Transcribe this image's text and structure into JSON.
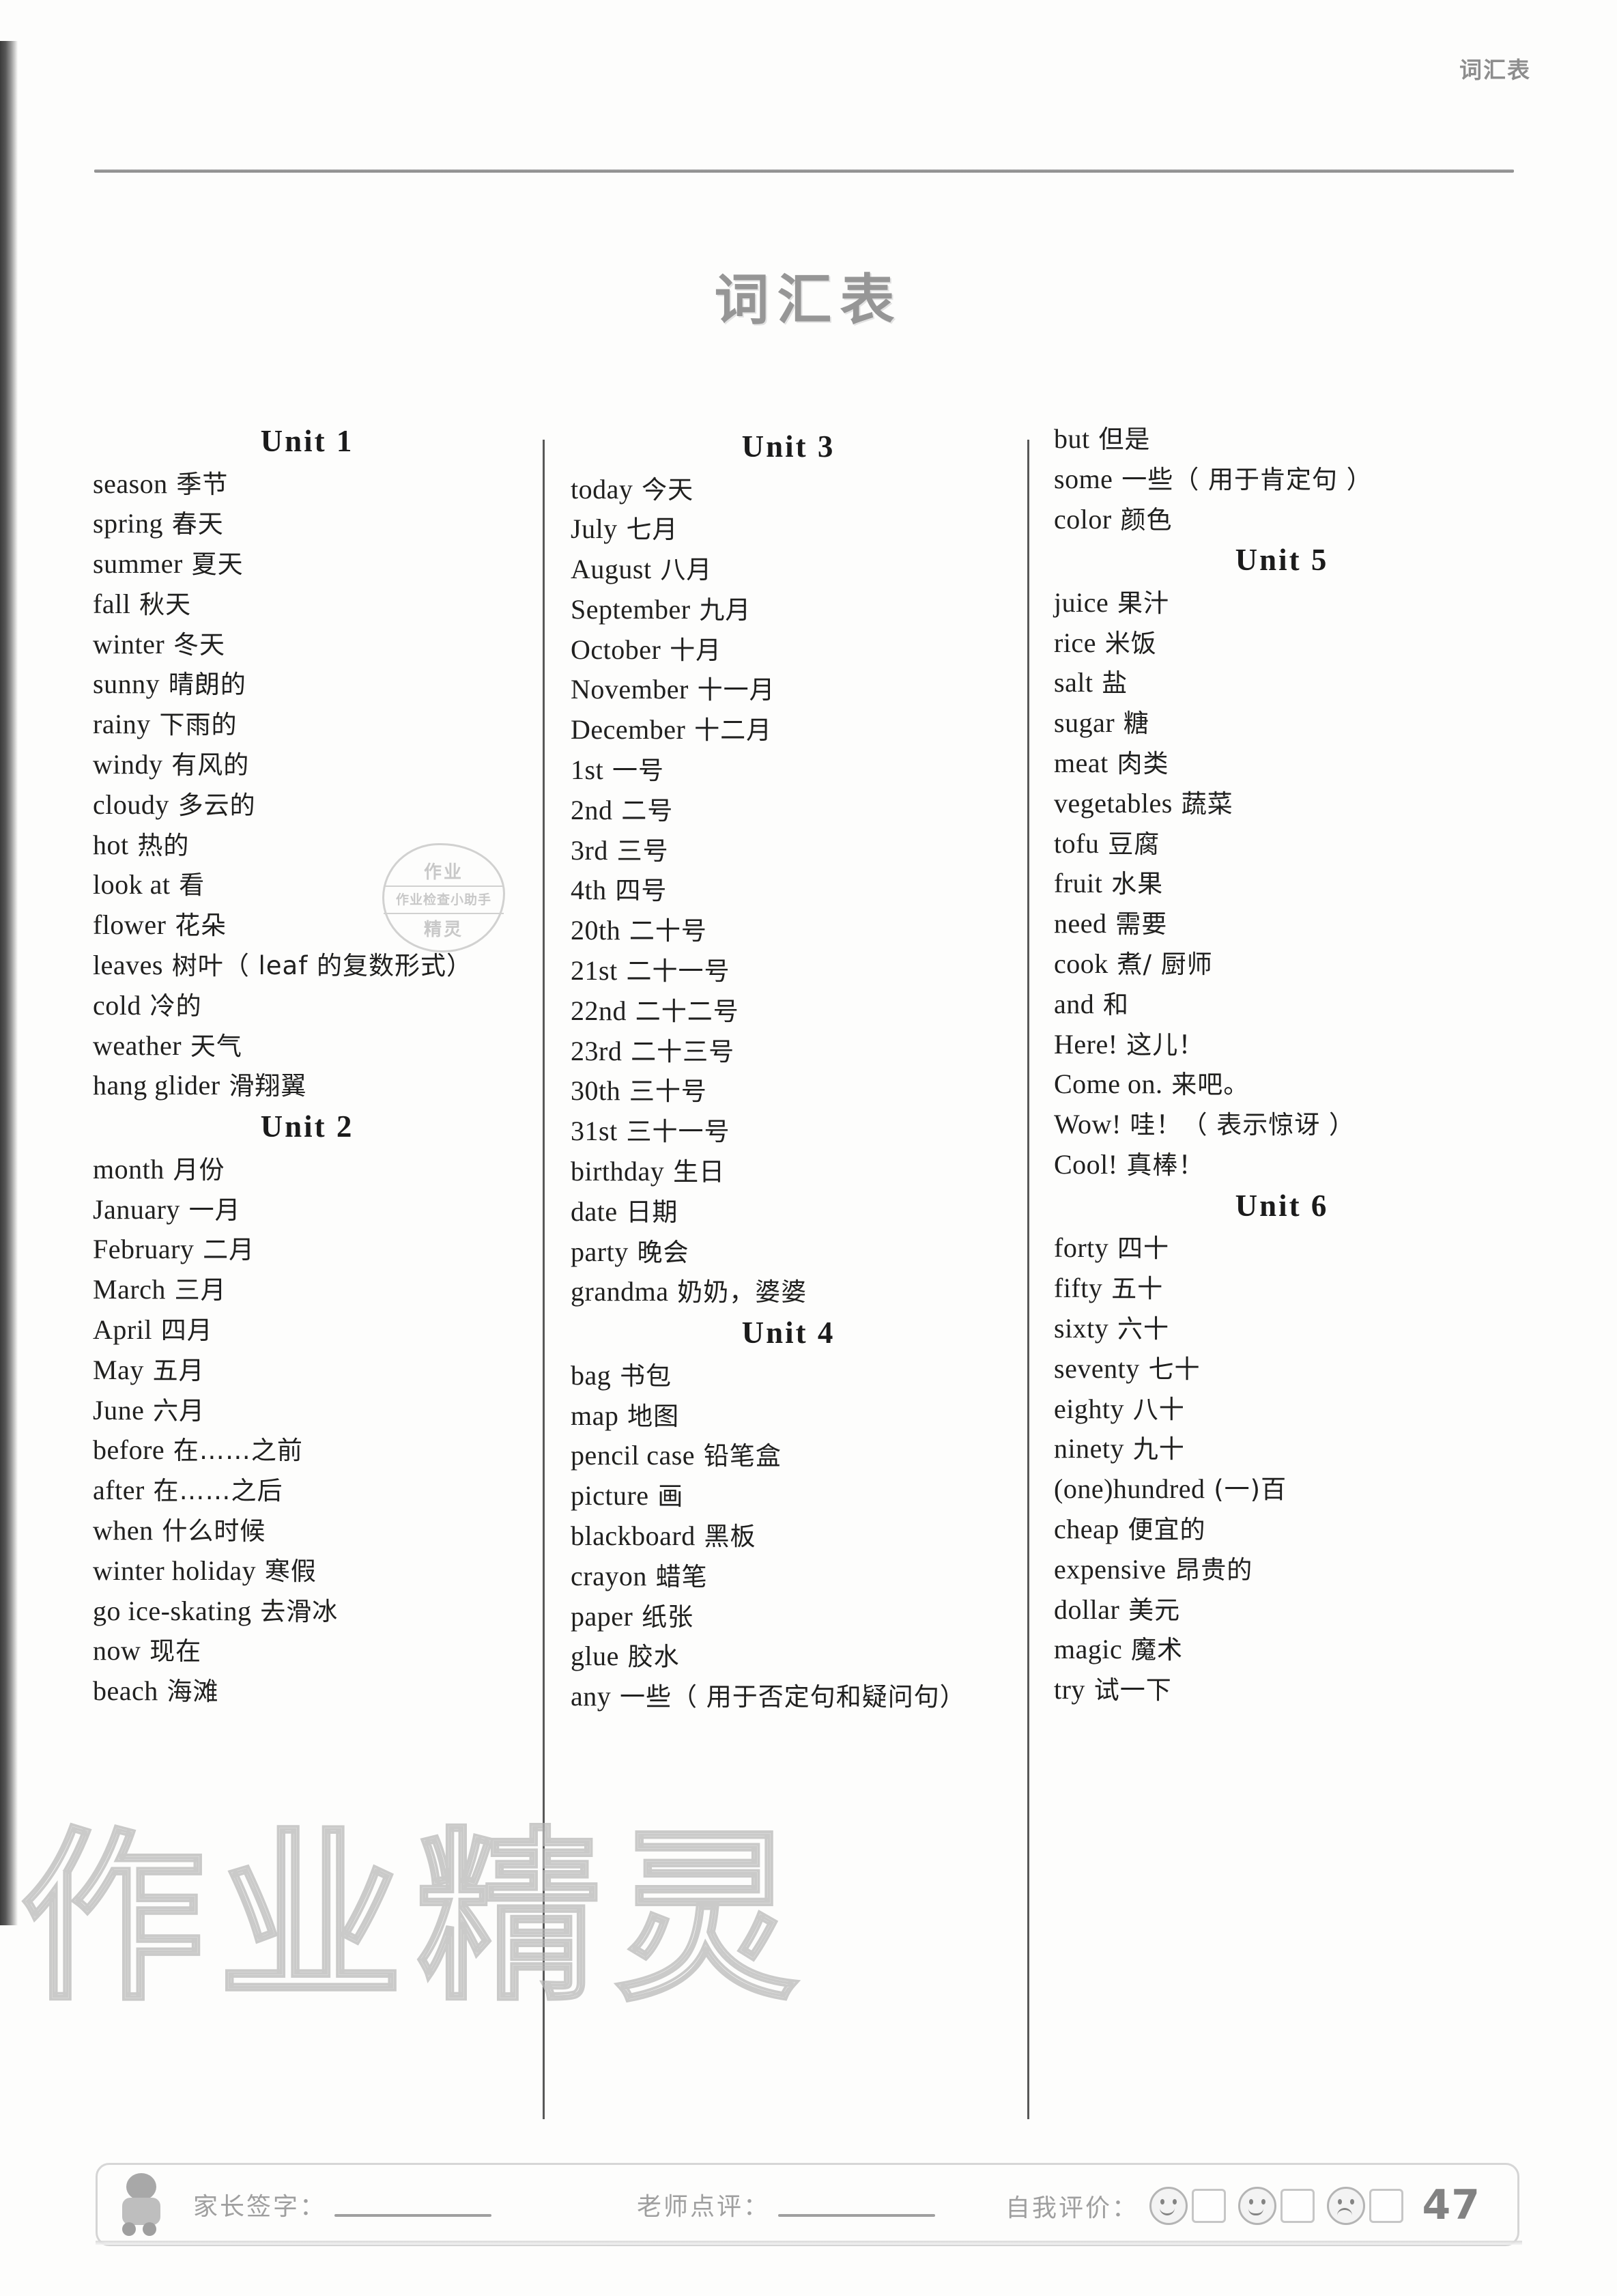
{
  "running_head": "词汇表",
  "page_title": "词汇表",
  "watermark": "作业精灵",
  "stamp": {
    "line1": "作业",
    "line2": "作业检查小助手",
    "line3": "精灵"
  },
  "columns": [
    {
      "id": "column-1",
      "blocks": [
        {
          "unit": "Unit 1",
          "entries": [
            {
              "en": "season",
              "cn": "季节"
            },
            {
              "en": "spring",
              "cn": "春天"
            },
            {
              "en": "summer",
              "cn": "夏天"
            },
            {
              "en": "fall",
              "cn": "秋天"
            },
            {
              "en": "winter",
              "cn": "冬天"
            },
            {
              "en": "sunny",
              "cn": "晴朗的"
            },
            {
              "en": "rainy",
              "cn": "下雨的"
            },
            {
              "en": "windy",
              "cn": "有风的"
            },
            {
              "en": "cloudy",
              "cn": "多云的"
            },
            {
              "en": "hot",
              "cn": "热的"
            },
            {
              "en": "look at",
              "cn": "看"
            },
            {
              "en": "flower",
              "cn": "花朵"
            },
            {
              "en": "leaves",
              "cn": "树叶（ leaf 的复数形式）"
            },
            {
              "en": "cold",
              "cn": "冷的"
            },
            {
              "en": "weather",
              "cn": "天气"
            },
            {
              "en": "hang glider",
              "cn": "滑翔翼"
            }
          ]
        },
        {
          "unit": "Unit 2",
          "entries": [
            {
              "en": "month",
              "cn": "月份"
            },
            {
              "en": "January",
              "cn": "一月"
            },
            {
              "en": "February",
              "cn": "二月"
            },
            {
              "en": "March",
              "cn": "三月"
            },
            {
              "en": "April",
              "cn": "四月"
            },
            {
              "en": "May",
              "cn": "五月"
            },
            {
              "en": "June",
              "cn": "六月"
            },
            {
              "en": "before",
              "cn": "在……之前"
            },
            {
              "en": "after",
              "cn": "在……之后"
            },
            {
              "en": "when",
              "cn": "什么时候"
            },
            {
              "en": "winter holiday",
              "cn": "寒假"
            },
            {
              "en": "go ice-skating",
              "cn": "去滑冰"
            },
            {
              "en": "now",
              "cn": "现在"
            },
            {
              "en": "beach",
              "cn": "海滩"
            }
          ]
        }
      ]
    },
    {
      "id": "column-2",
      "blocks": [
        {
          "unit": "Unit 3",
          "entries": [
            {
              "en": "today",
              "cn": "今天"
            },
            {
              "en": "July",
              "cn": "七月"
            },
            {
              "en": "August",
              "cn": "八月"
            },
            {
              "en": "September",
              "cn": "九月"
            },
            {
              "en": "October",
              "cn": "十月"
            },
            {
              "en": "November",
              "cn": "十一月"
            },
            {
              "en": "December",
              "cn": "十二月"
            },
            {
              "en": "1st",
              "cn": "一号"
            },
            {
              "en": "2nd",
              "cn": "二号"
            },
            {
              "en": "3rd",
              "cn": "三号"
            },
            {
              "en": "4th",
              "cn": "四号"
            },
            {
              "en": "20th",
              "cn": "二十号"
            },
            {
              "en": "21st",
              "cn": "二十一号"
            },
            {
              "en": "22nd",
              "cn": "二十二号"
            },
            {
              "en": "23rd",
              "cn": "二十三号"
            },
            {
              "en": "30th",
              "cn": "三十号"
            },
            {
              "en": "31st",
              "cn": "三十一号"
            },
            {
              "en": "birthday",
              "cn": "生日"
            },
            {
              "en": "date",
              "cn": "日期"
            },
            {
              "en": "party",
              "cn": "晚会"
            },
            {
              "en": "grandma",
              "cn": "奶奶，婆婆"
            }
          ]
        },
        {
          "unit": "Unit 4",
          "entries": [
            {
              "en": "bag",
              "cn": "书包"
            },
            {
              "en": "map",
              "cn": "地图"
            },
            {
              "en": "pencil case",
              "cn": "铅笔盒"
            },
            {
              "en": "picture",
              "cn": "画"
            },
            {
              "en": "blackboard",
              "cn": "黑板"
            },
            {
              "en": "crayon",
              "cn": "蜡笔"
            },
            {
              "en": "paper",
              "cn": "纸张"
            },
            {
              "en": "glue",
              "cn": "胶水"
            },
            {
              "en": "any",
              "cn": "一些（ 用于否定句和疑问句）"
            }
          ]
        }
      ]
    },
    {
      "id": "column-3",
      "blocks": [
        {
          "unit": "",
          "entries": [
            {
              "en": "but",
              "cn": "但是"
            },
            {
              "en": "some",
              "cn": "一些（ 用于肯定句 ）"
            },
            {
              "en": "color",
              "cn": "颜色"
            }
          ]
        },
        {
          "unit": "Unit 5",
          "entries": [
            {
              "en": "juice",
              "cn": "果汁"
            },
            {
              "en": "rice",
              "cn": "米饭"
            },
            {
              "en": "salt",
              "cn": "盐"
            },
            {
              "en": "sugar",
              "cn": "糖"
            },
            {
              "en": "meat",
              "cn": "肉类"
            },
            {
              "en": "vegetables",
              "cn": "蔬菜"
            },
            {
              "en": "tofu",
              "cn": "豆腐"
            },
            {
              "en": "fruit",
              "cn": "水果"
            },
            {
              "en": "need",
              "cn": "需要"
            },
            {
              "en": "cook",
              "cn": "煮/ 厨师"
            },
            {
              "en": "and",
              "cn": "和"
            },
            {
              "en": "Here!",
              "cn": "这儿！"
            },
            {
              "en": "Come on.",
              "cn": "来吧。"
            },
            {
              "en": "Wow!",
              "cn": "哇！（ 表示惊讶 ）"
            },
            {
              "en": "Cool!",
              "cn": "真棒！"
            }
          ]
        },
        {
          "unit": "Unit 6",
          "entries": [
            {
              "en": "forty",
              "cn": "四十"
            },
            {
              "en": "fifty",
              "cn": "五十"
            },
            {
              "en": "sixty",
              "cn": "六十"
            },
            {
              "en": "seventy",
              "cn": "七十"
            },
            {
              "en": "eighty",
              "cn": "八十"
            },
            {
              "en": "ninety",
              "cn": "九十"
            },
            {
              "en": "(one)hundred",
              "cn": "(一)百"
            },
            {
              "en": "cheap",
              "cn": "便宜的"
            },
            {
              "en": "expensive",
              "cn": "昂贵的"
            },
            {
              "en": "dollar",
              "cn": "美元"
            },
            {
              "en": "magic",
              "cn": "魔术"
            },
            {
              "en": "try",
              "cn": "试一下"
            }
          ]
        }
      ]
    }
  ],
  "footer": {
    "parent_signature_label": "家长签字：",
    "teacher_comment_label": "老师点评：",
    "self_evaluation_label": "自我评价：",
    "faces": [
      "happy-face",
      "neutral-face",
      "sad-face"
    ],
    "page_number": "47"
  }
}
